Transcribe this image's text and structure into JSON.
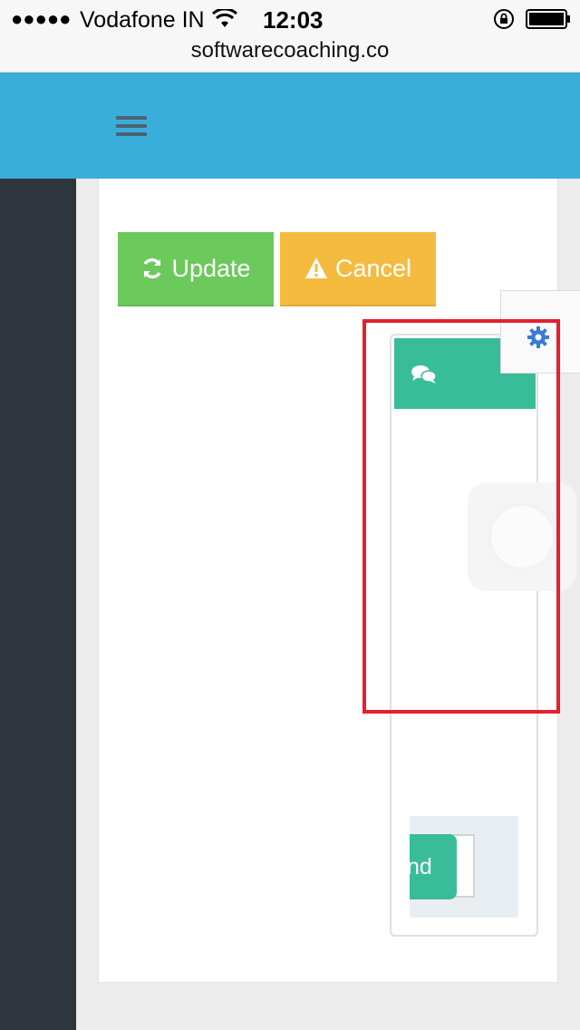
{
  "status_bar": {
    "signal": "●●●●●",
    "carrier": "Vodafone IN",
    "time": "12:03",
    "url": "softwarecoaching.co"
  },
  "header": {
    "menu_icon": "hamburger-menu-icon",
    "background_color": "#3aaedb"
  },
  "sidebar": {
    "background_color": "#2f353d"
  },
  "actions": {
    "update_label": "Update",
    "update_icon": "refresh-icon",
    "update_color": "#6cc95c",
    "cancel_label": "Cancel",
    "cancel_icon": "warning-icon",
    "cancel_color": "#f5bb3f"
  },
  "chat": {
    "header_icon": "comments-icon",
    "accent_color": "#38bd98",
    "send_label": "nd"
  },
  "settings": {
    "icon": "gear-icon",
    "icon_color": "#3b7bd4"
  },
  "annotation": {
    "color": "#e32030"
  }
}
